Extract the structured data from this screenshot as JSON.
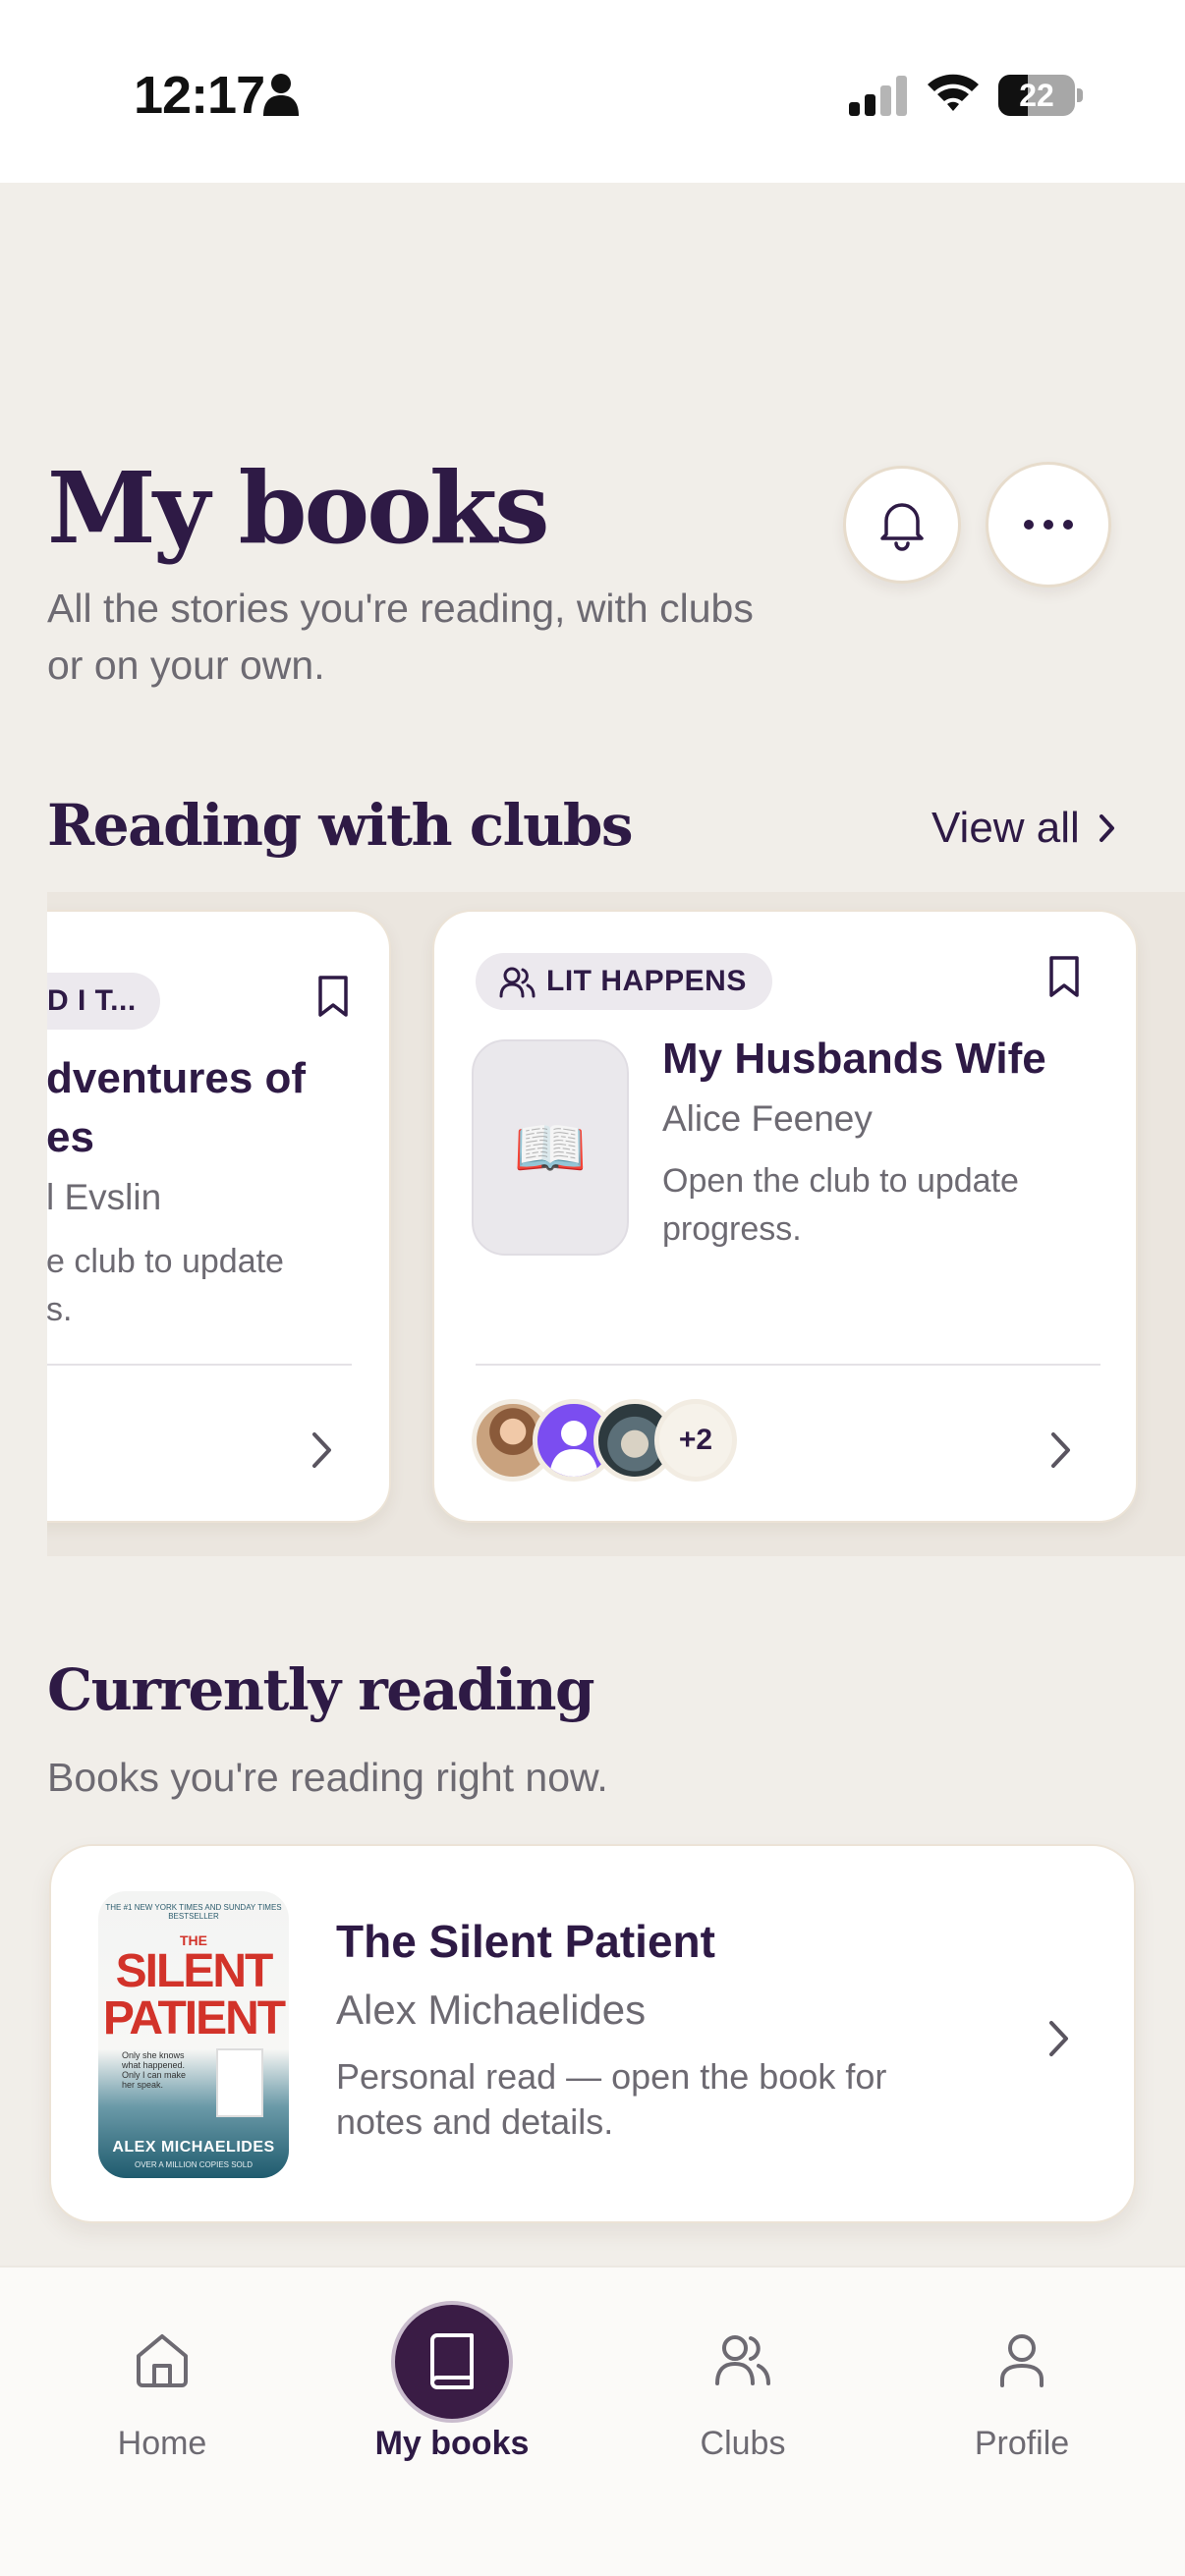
{
  "status_bar": {
    "time": "12:17",
    "battery": "22"
  },
  "header": {
    "title": "My books",
    "subtitle": "All the stories you're reading, with clubs or on your own."
  },
  "clubs_section": {
    "title": "Reading with clubs",
    "view_all": "View all",
    "cards": [
      {
        "club_tag": "D I T...",
        "title": "dventures of",
        "title_line2": "es",
        "author": "l Evslin",
        "note_line1": "e club to update",
        "note_line2": "s."
      },
      {
        "club_tag": "LIT HAPPENS",
        "title": "My Husbands Wife",
        "author": "Alice Feeney",
        "note": "Open the club to update progress.",
        "members_extra": "+2",
        "book_placeholder_icon": "📖"
      }
    ]
  },
  "currently_reading": {
    "title": "Currently reading",
    "subtitle": "Books you're reading right now.",
    "book": {
      "title": "The Silent Patient",
      "author": "Alex Michaelides",
      "note": "Personal read — open the book for notes and details.",
      "cover": {
        "top_line": "THE #1 NEW YORK TIMES AND SUNDAY TIMES BESTSELLER",
        "the": "THE",
        "title1": "SILENT",
        "title2": "PATIENT",
        "tagline": "Only she knows what happened. Only I can make her speak.",
        "author": "ALEX MICHAELIDES",
        "bottom": "OVER A MILLION COPIES SOLD"
      }
    }
  },
  "bottom_nav": {
    "items": [
      {
        "label": "Home",
        "icon": "home-icon"
      },
      {
        "label": "My books",
        "icon": "book-icon",
        "active": true
      },
      {
        "label": "Clubs",
        "icon": "users-icon"
      },
      {
        "label": "Profile",
        "icon": "user-icon"
      }
    ]
  },
  "colors": {
    "accent": "#3a1c45",
    "background": "#f1eee9",
    "text": "#2e1a45"
  }
}
